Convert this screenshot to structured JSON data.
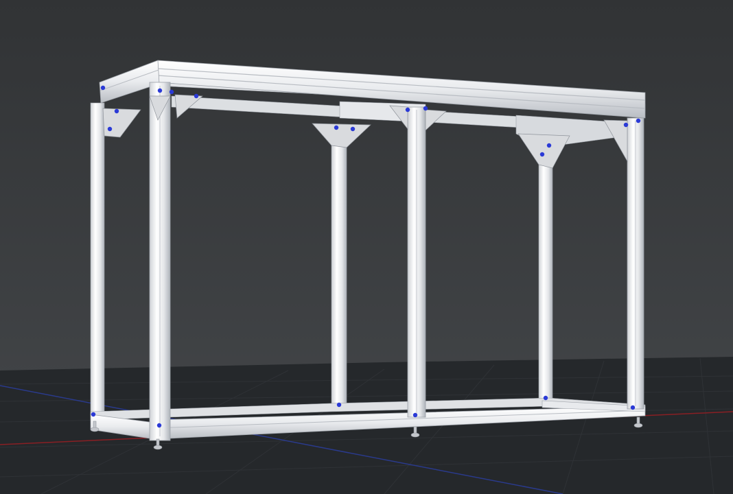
{
  "viewport": {
    "scene": "aluminum-extrusion-frame",
    "colors": {
      "background_top": "#313335",
      "background_bottom": "#45484b",
      "floor": "#25282b",
      "grid_line": "#2f3236",
      "axis_x": "#8a1f24",
      "axis_y": "#2a3a8c",
      "profile": "#f2f3f5",
      "profile_shade": "#c9ccd1",
      "profile_dark": "#9ca1a8",
      "connector": "#2b3ad6",
      "bracket": "#d9dbde"
    },
    "icons": {
      "connector": "connector-marker-icon",
      "foot": "leveling-foot-icon"
    }
  }
}
